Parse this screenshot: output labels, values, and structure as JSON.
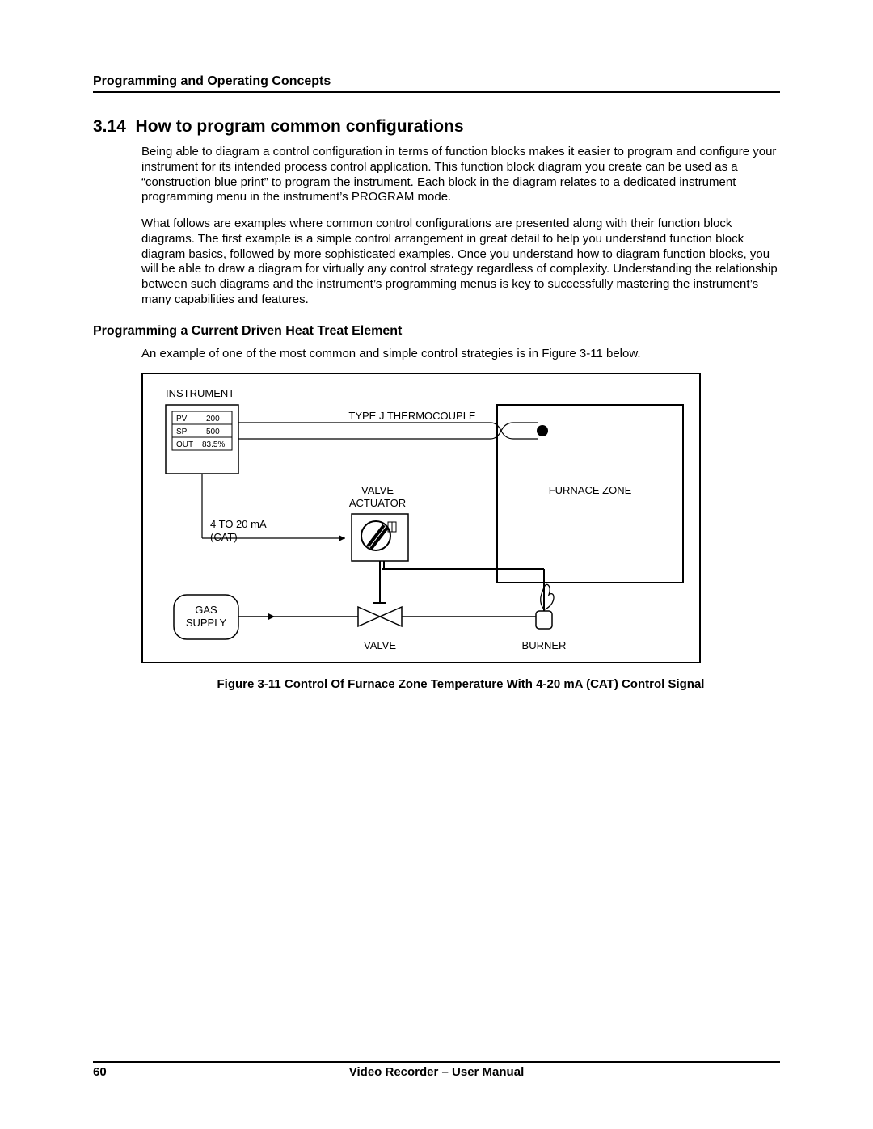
{
  "header": {
    "section_label": "Programming and Operating Concepts"
  },
  "section": {
    "number": "3.14",
    "title": "How to program common configurations",
    "para1": "Being able to diagram a control configuration in terms of function blocks makes it easier to program and configure your instrument for its intended process control application.  This function block diagram you create can be used as a “construction blue print” to program the instrument.  Each block in the diagram relates to a dedicated instrument programming menu in the instrument’s PROGRAM mode.",
    "para2": "What follows are examples where common control configurations are presented along with their function block diagrams.  The first example is a simple control arrangement in great detail to help you understand function block diagram basics, followed by more sophisticated examples.  Once you understand how to diagram function blocks, you will be able to draw a diagram for virtually any control strategy regardless of complexity.  Understanding the relationship between such diagrams and the instrument’s programming menus is key to successfully mastering the instrument’s many capabilities and features."
  },
  "subsection": {
    "title": "Programming a Current Driven Heat Treat Element",
    "intro": "An example of one of the most common and simple control strategies is in Figure 3-11 below."
  },
  "diagram": {
    "instrument_label": "INSTRUMENT",
    "display": {
      "pv_label": "PV",
      "pv_value": "200",
      "sp_label": "SP",
      "sp_value": "500",
      "out_label": "OUT",
      "out_value": "83.5%"
    },
    "thermocouple_label": "TYPE J THERMOCOUPLE",
    "valve_actuator_label_1": "VALVE",
    "valve_actuator_label_2": "ACTUATOR",
    "signal_label_1": "4 TO 20 mA",
    "signal_label_2": "(CAT)",
    "furnace_label": "FURNACE ZONE",
    "gas_label_1": "GAS",
    "gas_label_2": "SUPPLY",
    "valve_label": "VALVE",
    "burner_label": "BURNER"
  },
  "figure_caption": "Figure 3-11   Control Of Furnace Zone Temperature With 4-20 mA (CAT) Control Signal",
  "footer": {
    "page_number": "60",
    "manual_title": "Video Recorder – User Manual"
  }
}
